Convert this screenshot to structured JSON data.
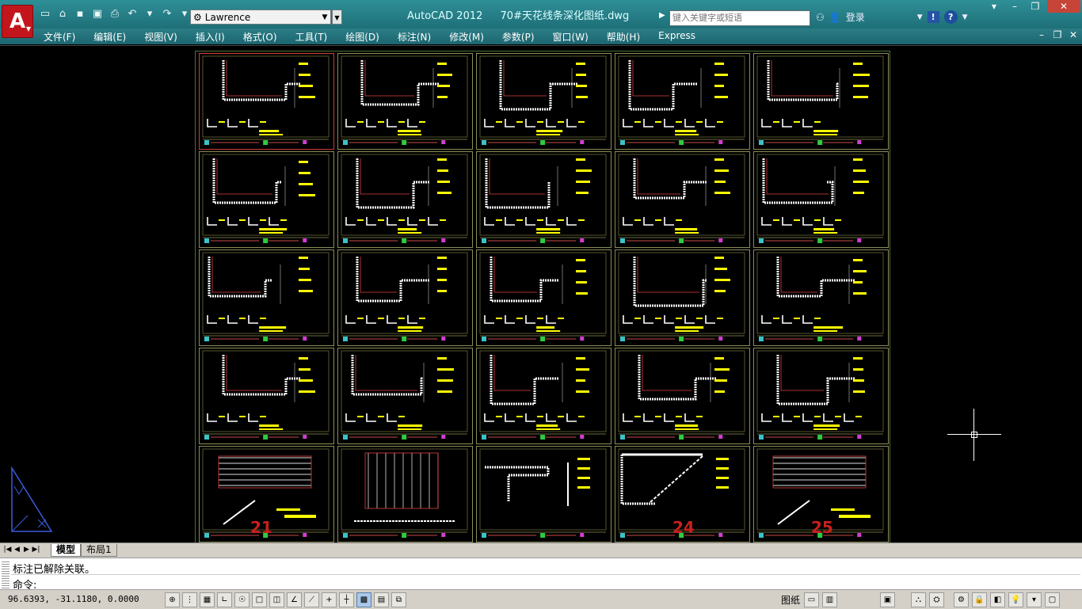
{
  "window": {
    "app_title": "AutoCAD 2012",
    "file_name": "70#天花线条深化图纸.dwg"
  },
  "app_button": {
    "label": "A"
  },
  "workspace": {
    "value": "Lawrence"
  },
  "search": {
    "placeholder": "键入关键字或短语"
  },
  "account": {
    "login_label": "登录"
  },
  "menu": {
    "items": [
      "文件(F)",
      "编辑(E)",
      "视图(V)",
      "插入(I)",
      "格式(O)",
      "工具(T)",
      "绘图(D)",
      "标注(N)",
      "修改(M)",
      "参数(P)",
      "窗口(W)",
      "帮助(H)",
      "Express"
    ]
  },
  "sheets": {
    "numbers_visible": [
      "21",
      "24",
      "25"
    ]
  },
  "layout_tabs": {
    "model": "模型",
    "layout1": "布局1"
  },
  "command": {
    "history": "标注已解除关联。",
    "prompt": "命令:"
  },
  "status": {
    "coordinates": "96.6393,  -31.1180, 0.0000",
    "paper_label": "图纸"
  },
  "colors": {
    "titlebar": "#1e6f78",
    "drawing_bg": "#000000",
    "sheet_border": "#8c8c58",
    "linework_yellow": "#ffff00",
    "linework_white": "#ffffff",
    "sheet_number_red": "#c8201c"
  }
}
